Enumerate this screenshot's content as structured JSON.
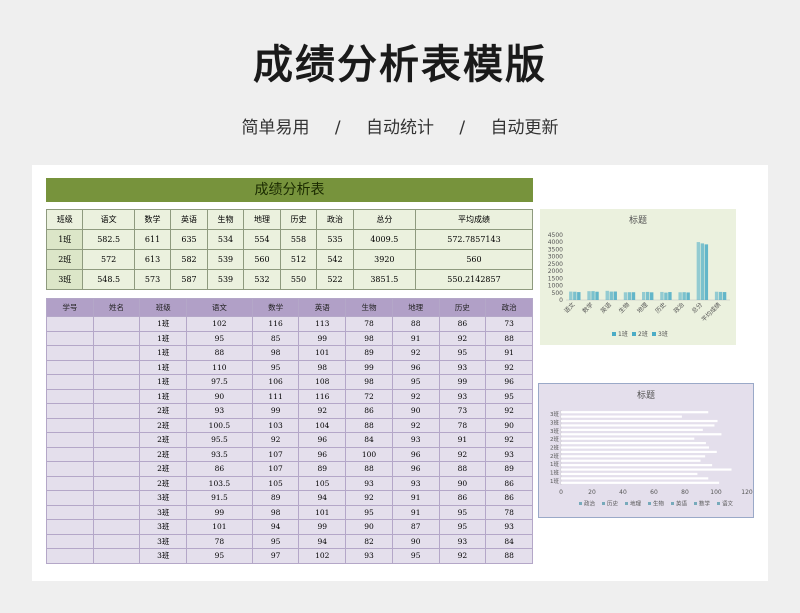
{
  "header": {
    "title": "成绩分析表模版",
    "tags": [
      "简单易用",
      "自动统计",
      "自动更新"
    ],
    "separator": "/"
  },
  "sheet": {
    "banner": "成绩分析表",
    "summary": {
      "columns": [
        "班级",
        "语文",
        "数学",
        "英语",
        "生物",
        "地理",
        "历史",
        "政治",
        "总分",
        "平均成绩"
      ],
      "rows": [
        [
          "1班",
          "582.5",
          "611",
          "635",
          "534",
          "554",
          "558",
          "535",
          "4009.5",
          "572.7857143"
        ],
        [
          "2班",
          "572",
          "613",
          "582",
          "539",
          "560",
          "512",
          "542",
          "3920",
          "560"
        ],
        [
          "3班",
          "548.5",
          "573",
          "587",
          "539",
          "532",
          "550",
          "522",
          "3851.5",
          "550.2142857"
        ]
      ]
    },
    "detail": {
      "columns": [
        "学号",
        "姓名",
        "班级",
        "语文",
        "数学",
        "英语",
        "生物",
        "地理",
        "历史",
        "政治"
      ],
      "rows": [
        [
          "",
          "",
          "1班",
          "102",
          "116",
          "113",
          "78",
          "88",
          "86",
          "73"
        ],
        [
          "",
          "",
          "1班",
          "95",
          "85",
          "99",
          "98",
          "91",
          "92",
          "88"
        ],
        [
          "",
          "",
          "1班",
          "88",
          "98",
          "101",
          "89",
          "92",
          "95",
          "91"
        ],
        [
          "",
          "",
          "1班",
          "110",
          "95",
          "98",
          "99",
          "96",
          "93",
          "92"
        ],
        [
          "",
          "",
          "1班",
          "97.5",
          "106",
          "108",
          "98",
          "95",
          "99",
          "96"
        ],
        [
          "",
          "",
          "1班",
          "90",
          "111",
          "116",
          "72",
          "92",
          "93",
          "95"
        ],
        [
          "",
          "",
          "2班",
          "93",
          "99",
          "92",
          "86",
          "90",
          "73",
          "92"
        ],
        [
          "",
          "",
          "2班",
          "100.5",
          "103",
          "104",
          "88",
          "92",
          "78",
          "90"
        ],
        [
          "",
          "",
          "2班",
          "95.5",
          "92",
          "96",
          "84",
          "93",
          "91",
          "92"
        ],
        [
          "",
          "",
          "2班",
          "93.5",
          "107",
          "96",
          "100",
          "96",
          "92",
          "93"
        ],
        [
          "",
          "",
          "2班",
          "86",
          "107",
          "89",
          "88",
          "96",
          "88",
          "89"
        ],
        [
          "",
          "",
          "2班",
          "103.5",
          "105",
          "105",
          "93",
          "93",
          "90",
          "86"
        ],
        [
          "",
          "",
          "3班",
          "91.5",
          "89",
          "94",
          "92",
          "91",
          "86",
          "86"
        ],
        [
          "",
          "",
          "3班",
          "99",
          "98",
          "101",
          "95",
          "91",
          "95",
          "78"
        ],
        [
          "",
          "",
          "3班",
          "101",
          "94",
          "99",
          "90",
          "87",
          "95",
          "93"
        ],
        [
          "",
          "",
          "3班",
          "78",
          "95",
          "94",
          "82",
          "90",
          "93",
          "84"
        ],
        [
          "",
          "",
          "3班",
          "95",
          "97",
          "102",
          "93",
          "95",
          "92",
          "88"
        ]
      ]
    }
  },
  "chart_data": [
    {
      "type": "bar",
      "title": "标题",
      "categories": [
        "语文",
        "数学",
        "英语",
        "生物",
        "地理",
        "历史",
        "政治",
        "总分",
        "平均成绩"
      ],
      "series": [
        {
          "name": "1班",
          "values": [
            582.5,
            611,
            635,
            534,
            554,
            558,
            535,
            4009.5,
            572.79
          ]
        },
        {
          "name": "2班",
          "values": [
            572,
            613,
            582,
            539,
            560,
            512,
            542,
            3920,
            560
          ]
        },
        {
          "name": "3班",
          "values": [
            548.5,
            573,
            587,
            539,
            532,
            550,
            522,
            3851.5,
            550.21
          ]
        }
      ],
      "y_ticks": [
        "4500",
        "4000",
        "3500",
        "3000",
        "2500",
        "2000",
        "1500",
        "1000",
        "500",
        "0"
      ],
      "ylim": [
        0,
        4500
      ],
      "legend": "bottom",
      "color": "#4bacc6"
    },
    {
      "type": "bar",
      "orientation": "horizontal",
      "title": "标题",
      "categories": [
        "1班",
        "1班",
        "1班",
        "1班",
        "1班",
        "1班",
        "2班",
        "2班",
        "2班",
        "2班",
        "2班",
        "2班",
        "3班",
        "3班",
        "3班",
        "3班",
        "3班"
      ],
      "axis_labels": [
        "1班",
        "1班",
        "1班",
        "2班",
        "2班",
        "2班",
        "3班",
        "3班",
        "3班"
      ],
      "x_ticks": [
        "0",
        "20",
        "40",
        "60",
        "80",
        "100",
        "120"
      ],
      "xlim": [
        0,
        120
      ],
      "legend_items": [
        "政治",
        "历史",
        "地理",
        "生物",
        "英语",
        "数学",
        "语文"
      ],
      "legend": "bottom",
      "color": "#ffffff"
    }
  ]
}
